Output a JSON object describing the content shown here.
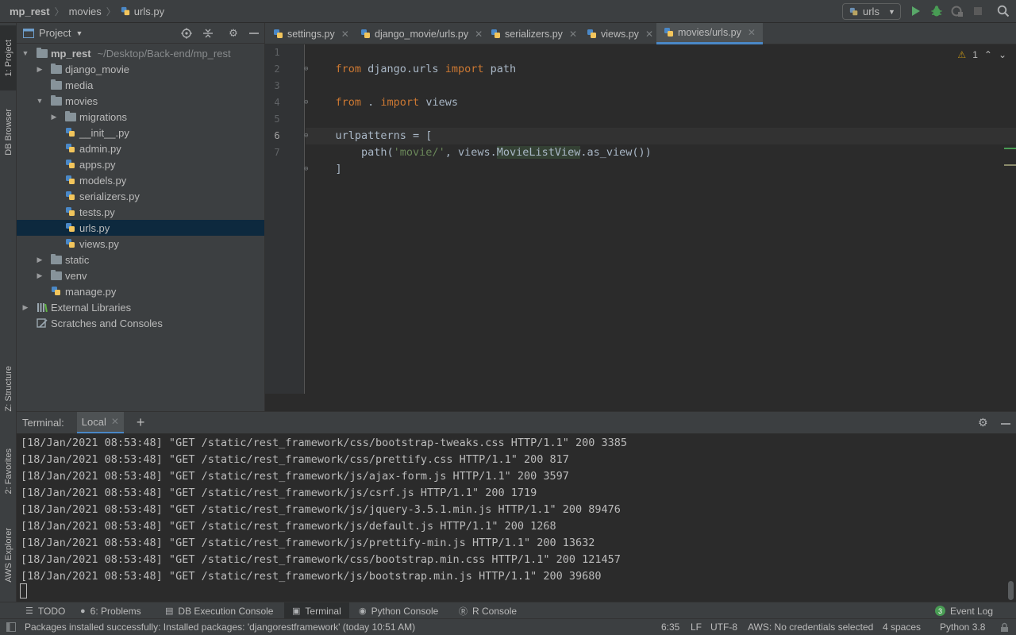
{
  "navbar": {
    "crumbs": [
      "mp_rest",
      "movies",
      "urls.py"
    ],
    "run_config": "urls"
  },
  "left_stripe": {
    "tabs": [
      "1: Project",
      "DB Browser",
      "Z: Structure",
      "2: Favorites",
      "AWS Explorer"
    ]
  },
  "project": {
    "title": "Project",
    "root_name": "mp_rest",
    "root_path": "~/Desktop/Back-end/mp_rest",
    "items": [
      {
        "label": "django_movie"
      },
      {
        "label": "media"
      },
      {
        "label": "movies"
      },
      {
        "label": "migrations"
      },
      {
        "label": "__init__.py"
      },
      {
        "label": "admin.py"
      },
      {
        "label": "apps.py"
      },
      {
        "label": "models.py"
      },
      {
        "label": "serializers.py"
      },
      {
        "label": "tests.py"
      },
      {
        "label": "urls.py"
      },
      {
        "label": "views.py"
      },
      {
        "label": "static"
      },
      {
        "label": "venv"
      },
      {
        "label": "manage.py"
      },
      {
        "label": "External Libraries"
      },
      {
        "label": "Scratches and Consoles"
      }
    ]
  },
  "editor": {
    "tabs": [
      "settings.py",
      "django_movie/urls.py",
      "serializers.py",
      "views.py",
      "movies/urls.py"
    ],
    "line_numbers": [
      "1",
      "2",
      "3",
      "4",
      "5",
      "6",
      "7"
    ],
    "code": {
      "l1": {
        "kw1": "from",
        "t1": " django.urls ",
        "kw2": "import",
        "t2": " path"
      },
      "l3": {
        "kw1": "from",
        "t1": " . ",
        "kw2": "import",
        "t2": " views"
      },
      "l5": {
        "t1": "urlpatterns = ["
      },
      "l6": {
        "t1": "    path(",
        "s1": "'movie/'",
        "t2": ", views.",
        "c1": "MovieListView",
        "t3": ".as_view())"
      },
      "l7": {
        "t1": "]"
      }
    },
    "warning_count": "1"
  },
  "terminal": {
    "title": "Terminal:",
    "tab": "Local",
    "lines": [
      "[18/Jan/2021 08:53:48] \"GET /static/rest_framework/css/bootstrap-tweaks.css HTTP/1.1\" 200 3385",
      "[18/Jan/2021 08:53:48] \"GET /static/rest_framework/css/prettify.css HTTP/1.1\" 200 817",
      "[18/Jan/2021 08:53:48] \"GET /static/rest_framework/js/ajax-form.js HTTP/1.1\" 200 3597",
      "[18/Jan/2021 08:53:48] \"GET /static/rest_framework/js/csrf.js HTTP/1.1\" 200 1719",
      "[18/Jan/2021 08:53:48] \"GET /static/rest_framework/js/jquery-3.5.1.min.js HTTP/1.1\" 200 89476",
      "[18/Jan/2021 08:53:48] \"GET /static/rest_framework/js/default.js HTTP/1.1\" 200 1268",
      "[18/Jan/2021 08:53:48] \"GET /static/rest_framework/js/prettify-min.js HTTP/1.1\" 200 13632",
      "[18/Jan/2021 08:53:48] \"GET /static/rest_framework/css/bootstrap.min.css HTTP/1.1\" 200 121457",
      "[18/Jan/2021 08:53:48] \"GET /static/rest_framework/js/bootstrap.min.js HTTP/1.1\" 200 39680"
    ]
  },
  "tool_strip": {
    "todo": "TODO",
    "problems": "6: Problems",
    "db_console": "DB Execution Console",
    "terminal": "Terminal",
    "python_console": "Python Console",
    "r_console": "R Console",
    "event_log": "Event Log",
    "event_count": "3"
  },
  "status_bar": {
    "message": "Packages installed successfully: Installed packages: 'djangorestframework' (today 10:51 AM)",
    "position": "6:35",
    "line_sep": "LF",
    "encoding": "UTF-8",
    "aws": "AWS: No credentials selected",
    "indent": "4 spaces",
    "interpreter": "Python 3.8"
  },
  "colors": {
    "accent": "#4a88c7",
    "selection": "#0d293e",
    "keyword": "#cc7832",
    "string": "#6a8759"
  }
}
